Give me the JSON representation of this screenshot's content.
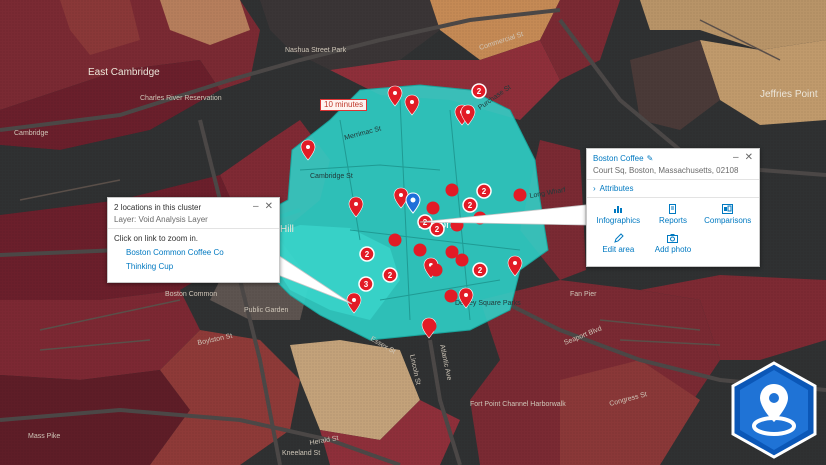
{
  "map": {
    "neighborhoods": [
      "East Cambridge",
      "Jeffries Point",
      "Cambridge",
      "Boston",
      "Hill"
    ],
    "streets": [
      "Commercial St",
      "Atlantic Ave",
      "Boylston St",
      "Essex St",
      "Herald St",
      "Mass Pike",
      "Congress St",
      "Seaport Blvd",
      "Fan Pier",
      "Cambridge St",
      "Merrimac St",
      "Long Wharf",
      "Lincoln St",
      "Kneeland St",
      "Purchase St",
      "Charles River Reservation",
      "Nashua Street Park",
      "Boston Common",
      "Public Garden",
      "Dewey Square Parks",
      "Fort Point Channel Harborwalk"
    ],
    "drive_time_label": "10 minutes",
    "cluster_counts": [
      "2",
      "2",
      "2",
      "2",
      "2",
      "2",
      "2",
      "3",
      "2"
    ]
  },
  "cluster_popup": {
    "title": "2 locations in this cluster",
    "layer": "Layer: Void Analysis Layer",
    "hint": "Click on link to zoom in.",
    "links": [
      "Boston Common Coffee Co",
      "Thinking Cup"
    ],
    "min_icon": "minimize-icon",
    "close_icon": "close-icon"
  },
  "feature_popup": {
    "title": "Boston Coffee",
    "address": "Court Sq, Boston, Massachusetts, 02108",
    "attributes_label": "Attributes",
    "actions": [
      {
        "label": "Infographics",
        "icon": "bar-chart-icon"
      },
      {
        "label": "Reports",
        "icon": "document-icon"
      },
      {
        "label": "Comparisons",
        "icon": "compare-icon"
      },
      {
        "label": "Edit area",
        "icon": "pencil-icon"
      },
      {
        "label": "Add photo",
        "icon": "camera-icon"
      }
    ]
  },
  "colors": {
    "drive_area": "#2fd3c9",
    "marker": "#e21b26",
    "accent": "#0079c1",
    "tract_dark": "#6b1f2b",
    "tract_mid": "#8e3a38",
    "tract_light": "#b9835f"
  },
  "app_badge": "arcgis-business-analyst-icon"
}
